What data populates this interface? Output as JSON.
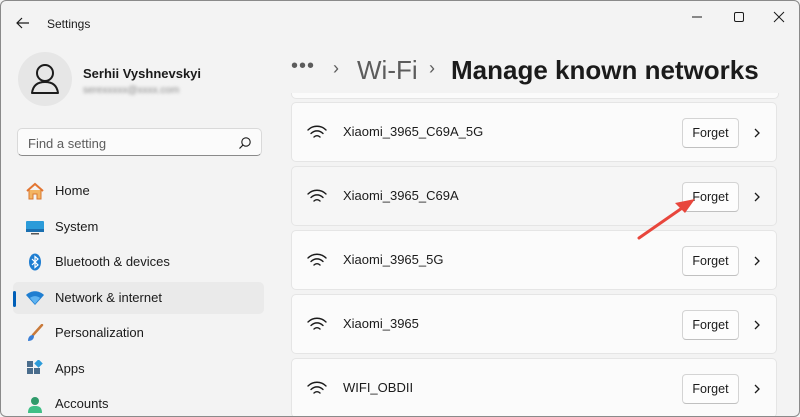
{
  "window": {
    "title": "Settings"
  },
  "profile": {
    "name": "Serhii Vyshnevskyi",
    "email": "serexxxxx@xxxx.com"
  },
  "search": {
    "placeholder": "Find a setting"
  },
  "nav": {
    "items": [
      {
        "label": "Home",
        "icon": "home-icon"
      },
      {
        "label": "System",
        "icon": "system-icon"
      },
      {
        "label": "Bluetooth & devices",
        "icon": "bluetooth-icon"
      },
      {
        "label": "Network & internet",
        "icon": "network-icon",
        "selected": true
      },
      {
        "label": "Personalization",
        "icon": "brush-icon"
      },
      {
        "label": "Apps",
        "icon": "apps-icon"
      },
      {
        "label": "Accounts",
        "icon": "accounts-icon"
      }
    ]
  },
  "breadcrumb": {
    "overflow": "•••",
    "parent": "Wi-Fi",
    "current": "Manage known networks",
    "separator": "›"
  },
  "networks": [
    {
      "name": "Xiaomi_3965_C69A_5G",
      "action": "Forget"
    },
    {
      "name": "Xiaomi_3965_C69A",
      "action": "Forget"
    },
    {
      "name": "Xiaomi_3965_5G",
      "action": "Forget"
    },
    {
      "name": "Xiaomi_3965",
      "action": "Forget"
    },
    {
      "name": "WIFI_OBDII",
      "action": "Forget"
    }
  ],
  "colors": {
    "accent": "#005fb8",
    "annotation_arrow": "#e8463c",
    "background": "#f3f3f3",
    "card": "#fbfbfb"
  }
}
